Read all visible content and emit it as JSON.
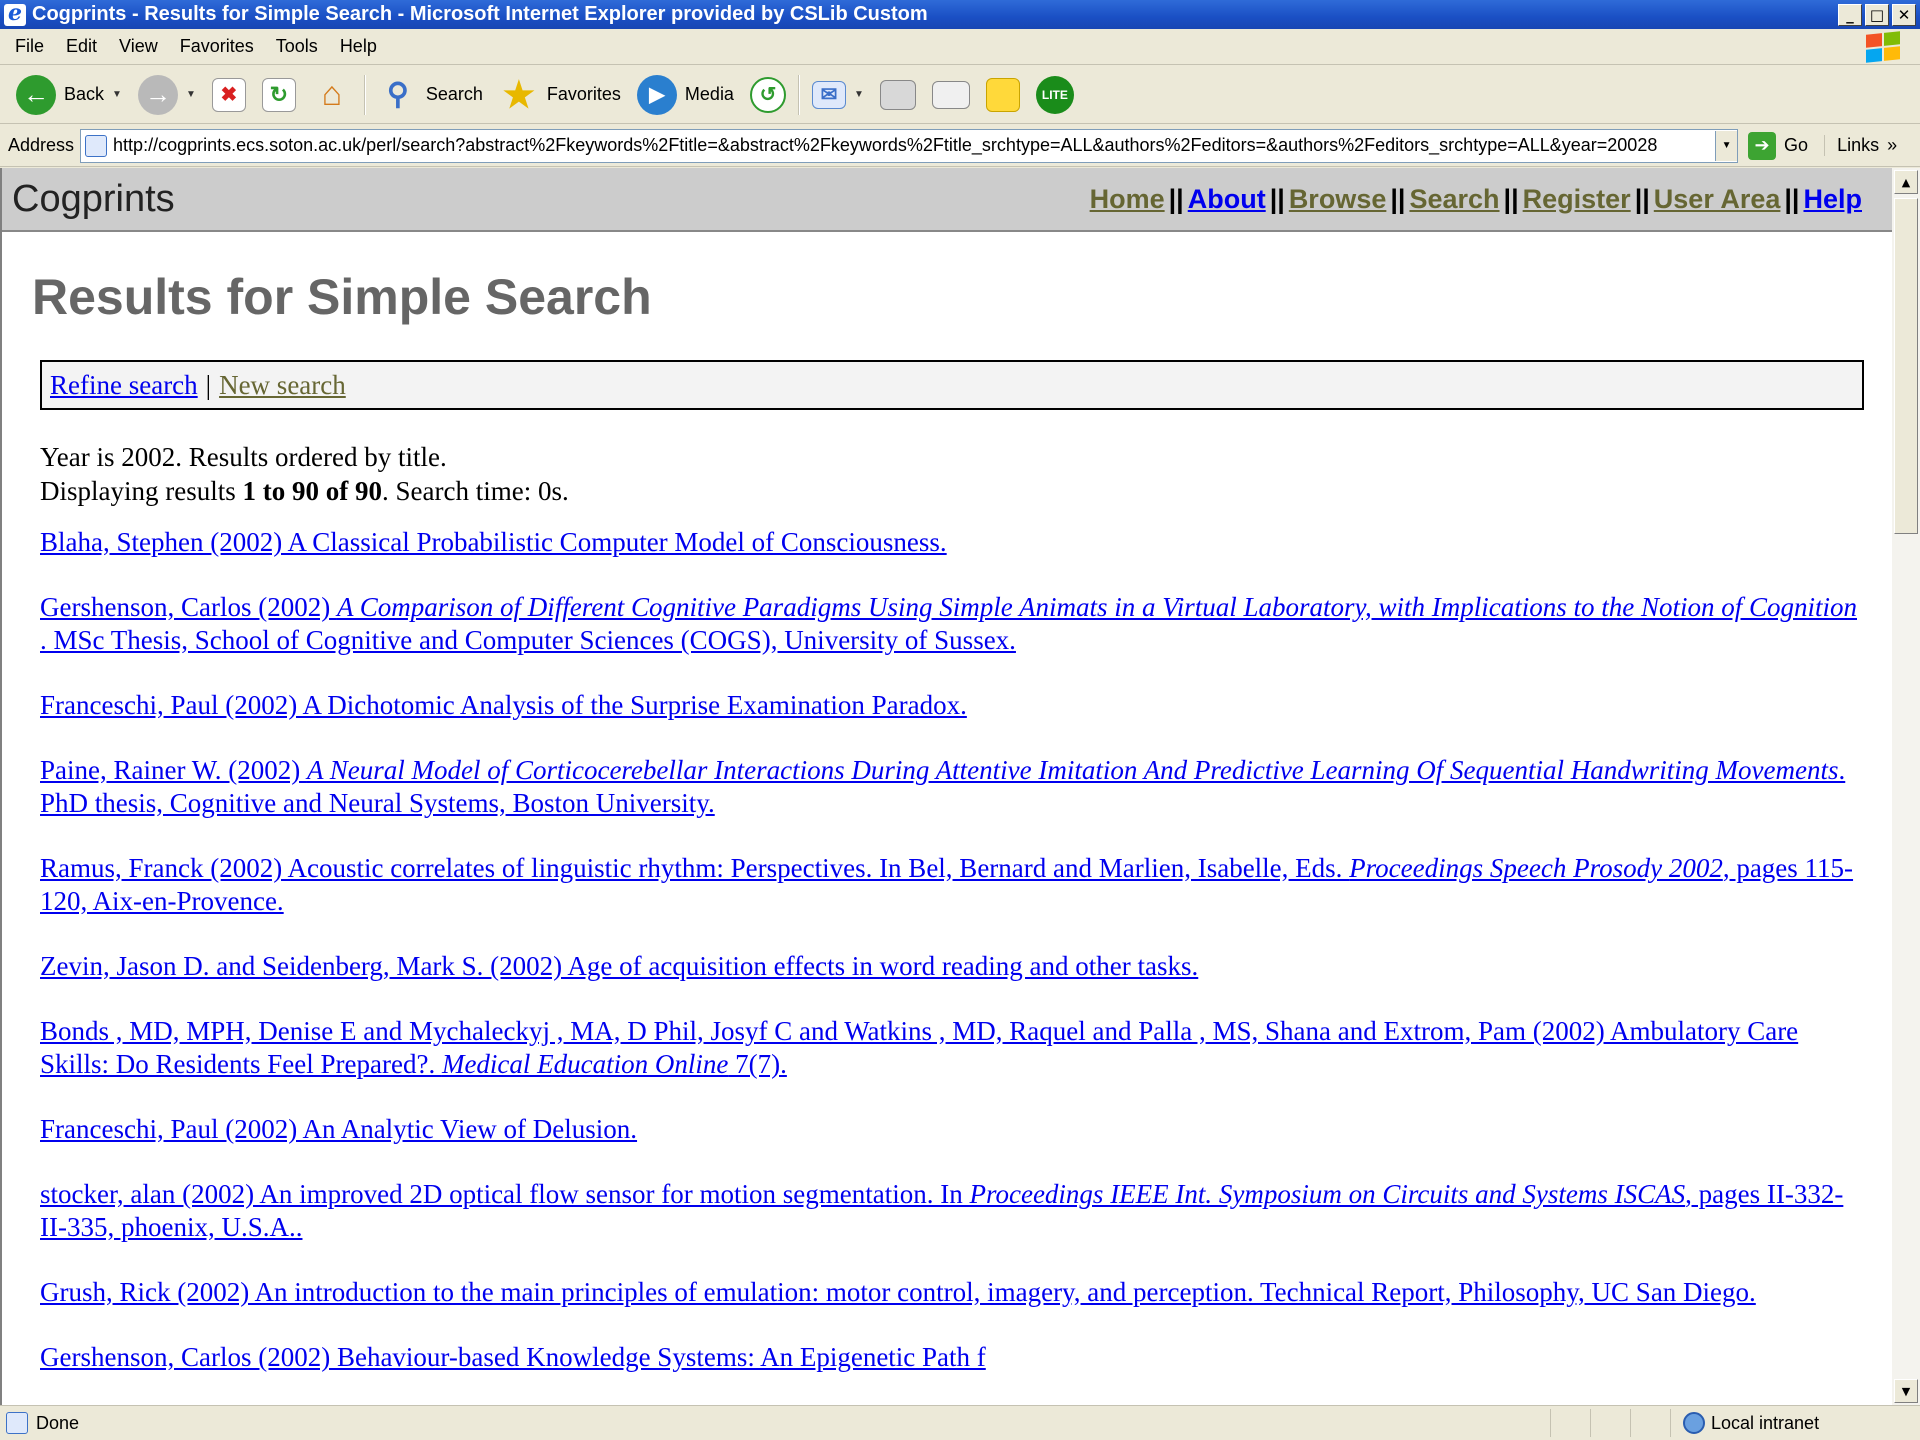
{
  "window": {
    "title": "Cogprints - Results for Simple Search - Microsoft Internet Explorer provided by CSLib Custom",
    "controls": [
      "_",
      "□",
      "✕"
    ]
  },
  "menu": [
    "File",
    "Edit",
    "View",
    "Favorites",
    "Tools",
    "Help"
  ],
  "toolbar": {
    "back": "Back",
    "search": "Search",
    "favorites": "Favorites",
    "media": "Media",
    "icons": [
      "back-icon",
      "forward-icon",
      "stop-icon",
      "refresh-icon",
      "home-icon",
      "search-icon",
      "favorites-icon",
      "media-icon",
      "history-icon",
      "mail-icon",
      "print-icon",
      "edit-icon",
      "note-icon",
      "bug-icon"
    ]
  },
  "address": {
    "label": "Address",
    "url": "http://cogprints.ecs.soton.ac.uk/perl/search?abstract%2Fkeywords%2Ftitle=&abstract%2Fkeywords%2Ftitle_srchtype=ALL&authors%2Feditors=&authors%2Feditors_srchtype=ALL&year=20028",
    "go": "Go",
    "links": "Links",
    "links_chevron": "»"
  },
  "site": {
    "name": "Cogprints",
    "nav": [
      {
        "label": "Home",
        "visited": true
      },
      {
        "label": "About",
        "visited": false
      },
      {
        "label": "Browse",
        "visited": true
      },
      {
        "label": "Search",
        "visited": true
      },
      {
        "label": "Register",
        "visited": true
      },
      {
        "label": "User Area",
        "visited": true
      },
      {
        "label": "Help",
        "visited": false
      }
    ],
    "nav_divider": "||"
  },
  "page": {
    "title": "Results for Simple Search",
    "refine": "Refine search",
    "controls_pipe": "|",
    "new_search": "New search",
    "summary_line1": "Year is 2002. Results ordered by title.",
    "summary_line2_a": "Displaying results ",
    "summary_from": "1",
    "summary_to_word": " to ",
    "summary_to": "90",
    "summary_of_word": " of ",
    "summary_total": "90",
    "summary_line2_b": ". Search time: 0s."
  },
  "results": [
    {
      "pre": "Blaha, Stephen (2002) A Classical Probabilistic Computer Model of Consciousness.",
      "italic": "",
      "post": ""
    },
    {
      "pre": "Gershenson, Carlos (2002) ",
      "italic": "A Comparison of Different Cognitive Paradigms Using Simple Animats in a Virtual Laboratory, with Implications to the Notion of Cognition",
      "post": " . MSc Thesis, School of Cognitive and Computer Sciences (COGS), University of Sussex."
    },
    {
      "pre": "Franceschi, Paul (2002) A Dichotomic Analysis of the Surprise Examination Paradox.",
      "italic": "",
      "post": ""
    },
    {
      "pre": "Paine, Rainer W. (2002) ",
      "italic": "A Neural Model of Corticocerebellar Interactions During Attentive Imitation And Predictive Learning Of Sequential Handwriting Movements",
      "post": ". PhD thesis, Cognitive and Neural Systems, Boston University."
    },
    {
      "pre": "Ramus, Franck (2002) Acoustic correlates of linguistic rhythm: Perspectives. In Bel, Bernard and Marlien, Isabelle, Eds. ",
      "italic": "Proceedings Speech Prosody 2002",
      "post": ", pages 115-120, Aix-en-Provence."
    },
    {
      "pre": "Zevin, Jason D. and Seidenberg, Mark S. (2002) Age of acquisition effects in word reading and other tasks.",
      "italic": "",
      "post": ""
    },
    {
      "pre": "Bonds , MD, MPH, Denise E and Mychaleckyj , MA, D Phil, Josyf C and Watkins , MD, Raquel and Palla , MS, Shana and Extrom, Pam (2002) Ambulatory Care Skills: Do Residents Feel Prepared?. ",
      "italic": "Medical Education Online",
      "post": " 7(7)."
    },
    {
      "pre": "Franceschi, Paul (2002) An Analytic View of Delusion.",
      "italic": "",
      "post": ""
    },
    {
      "pre": "stocker, alan (2002) An improved 2D optical flow sensor for motion segmentation. In ",
      "italic": "Proceedings IEEE Int. Symposium on Circuits and Systems ISCAS",
      "post": ", pages II-332-II-335, phoenix, U.S.A.."
    },
    {
      "pre": "Grush, Rick (2002) An introduction to the main principles of emulation: motor control, imagery, and perception. Technical Report, Philosophy, UC San Diego.",
      "italic": "",
      "post": ""
    },
    {
      "pre": "Gershenson, Carlos (2002) Behaviour-based Knowledge Systems: An Epigenetic Path f",
      "italic": "",
      "post": ""
    }
  ],
  "status": {
    "text": "Done",
    "zone": "Local intranet"
  },
  "scrollbar": {
    "up": "▲",
    "down": "▼"
  }
}
